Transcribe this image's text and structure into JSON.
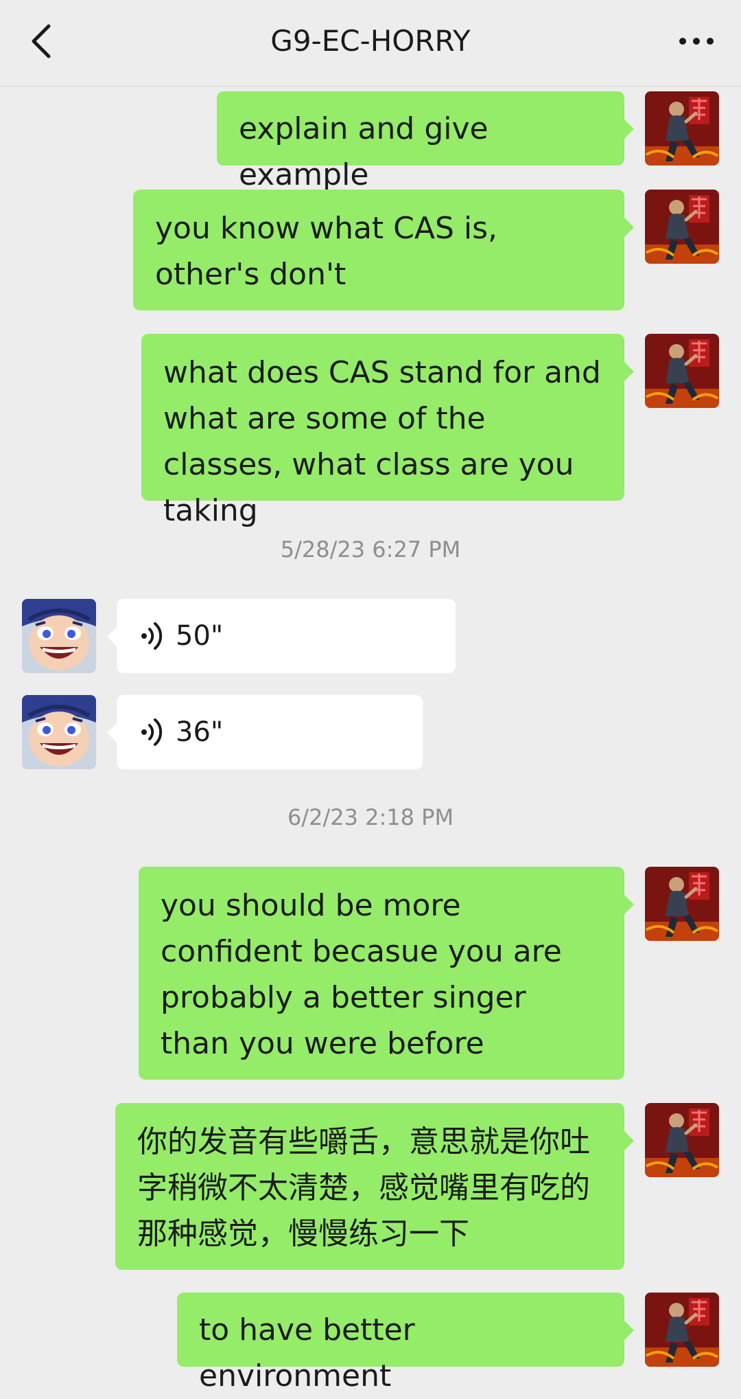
{
  "header": {
    "title": "G9-EC-HORRY",
    "back_icon": "chevron-left-icon",
    "more_icon": "more-dots-icon"
  },
  "colors": {
    "outgoing_bubble": "#95ec69",
    "incoming_bubble": "#ffffff",
    "background": "#ededed",
    "timestamp_text": "#8e8e8e"
  },
  "messages": {
    "m1": {
      "text": "explain and give example"
    },
    "m2": {
      "text": "you know what CAS is, other's don't"
    },
    "m3": {
      "text": "what does CAS stand for and what are some of the classes, what class are you taking"
    },
    "ts1": {
      "text": "5/28/23 6:27 PM"
    },
    "v1": {
      "duration": "50\""
    },
    "v2": {
      "duration": "36\""
    },
    "ts2": {
      "text": "6/2/23 2:18 PM"
    },
    "m4": {
      "text": "you should be more confident becasue you are probably a better singer than you were before"
    },
    "m5": {
      "text": "你的发音有些嚼舌，意思就是你吐字稍微不太清楚，感觉嘴里有吃的那种感觉，慢慢练习一下"
    },
    "m6": {
      "text": "to have better environment"
    }
  }
}
